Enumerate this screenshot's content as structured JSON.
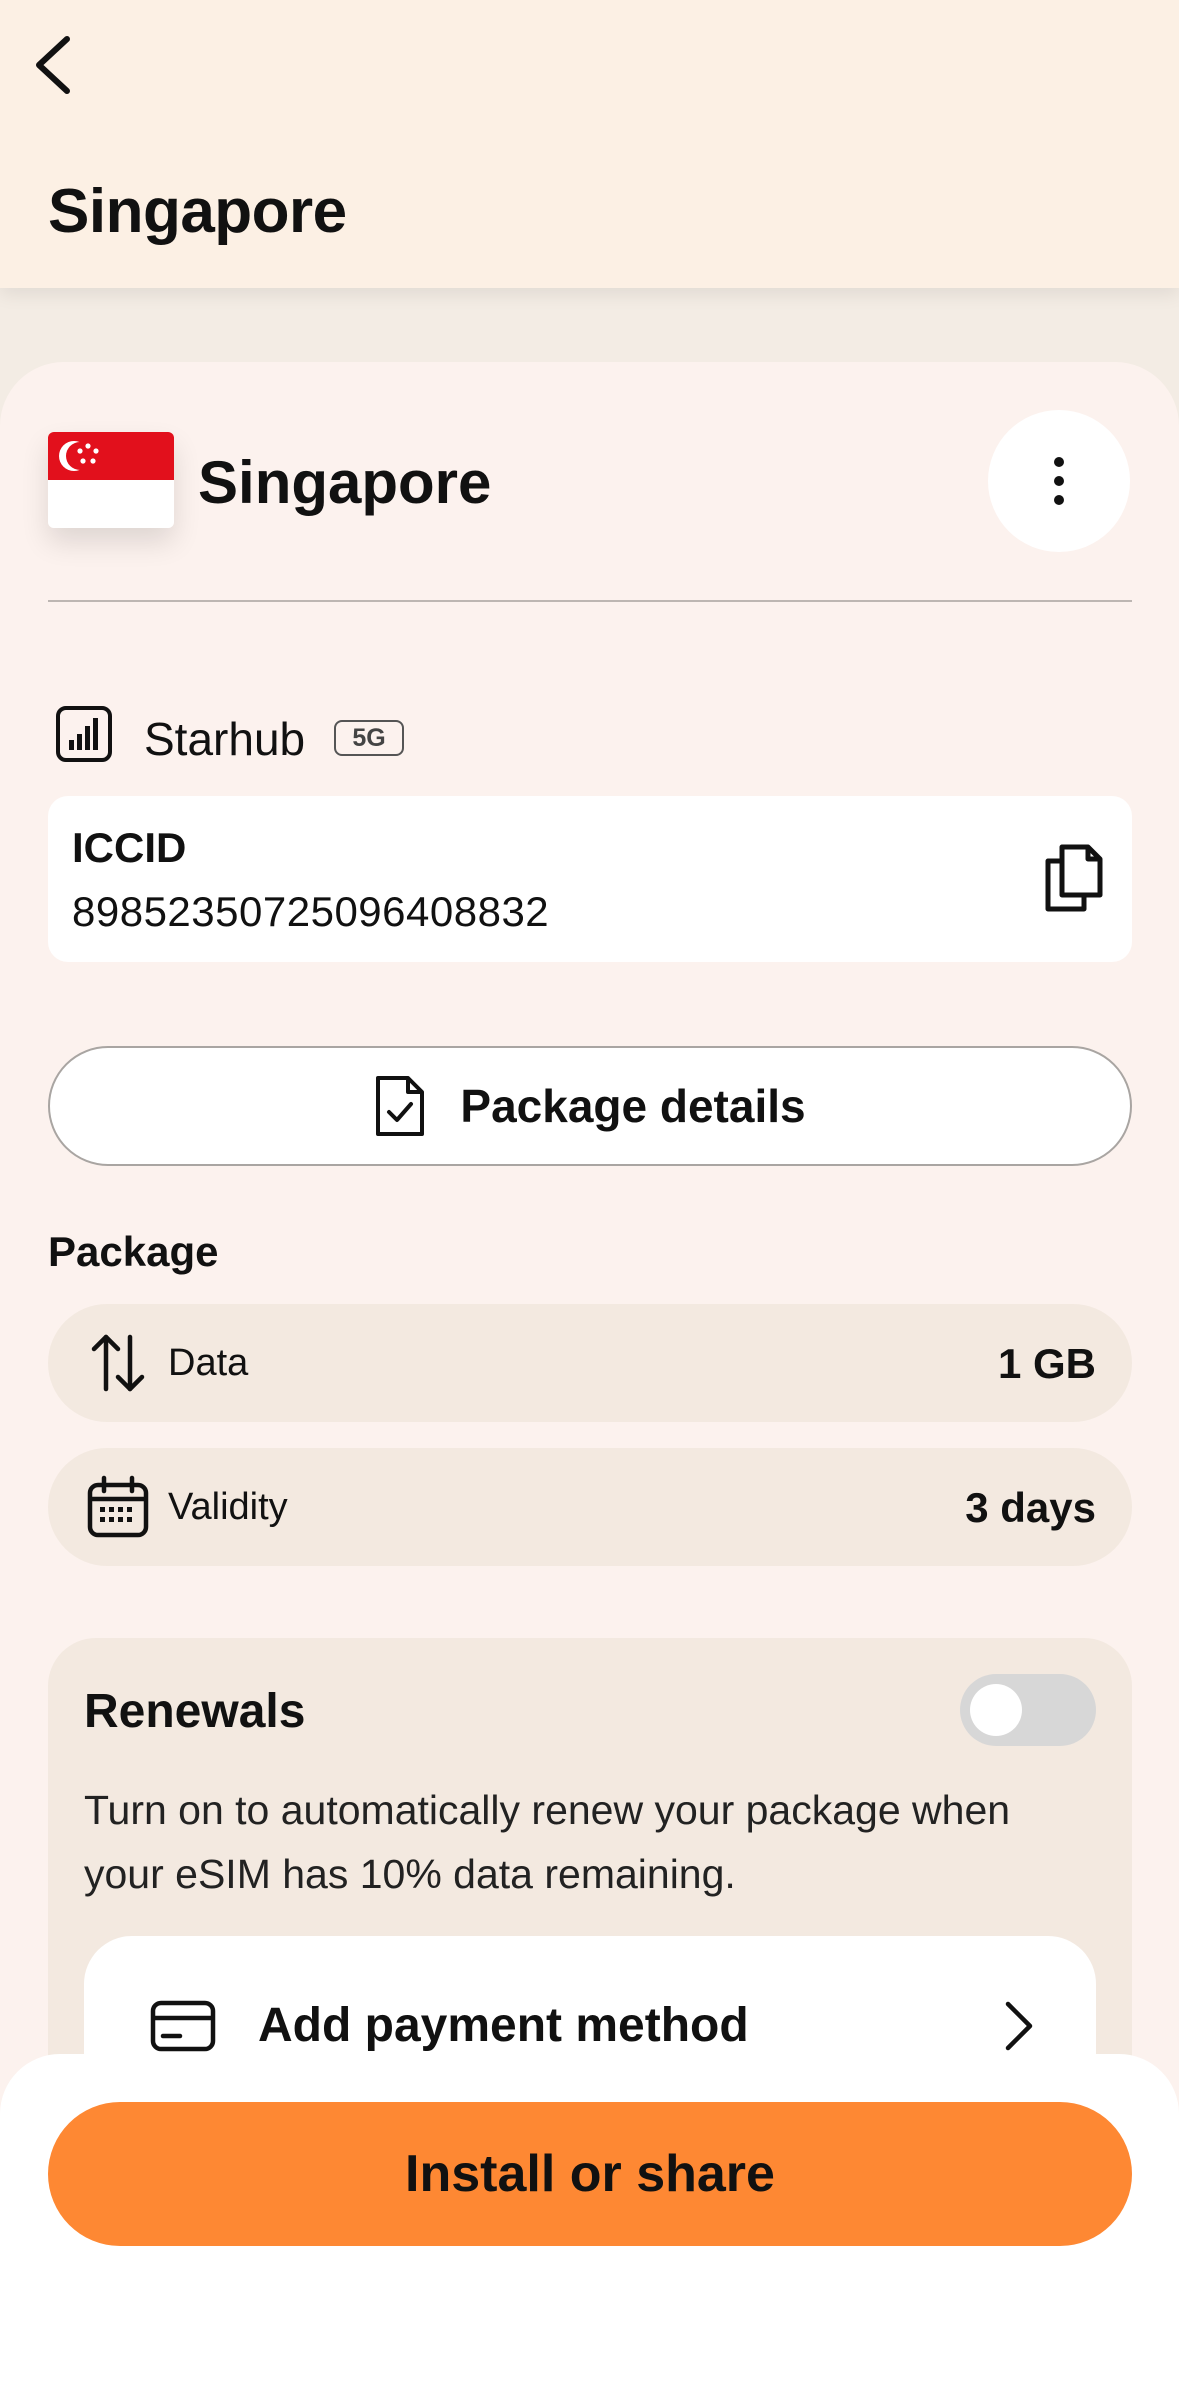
{
  "header": {
    "title": "Singapore"
  },
  "esim": {
    "country": "Singapore",
    "network": "Starhub",
    "network_badge": "5G",
    "iccid_label": "ICCID",
    "iccid_value": "8985235072509640​8832"
  },
  "buttons": {
    "package_details": "Package details",
    "install_or_share": "Install or share"
  },
  "package": {
    "section_title": "Package",
    "rows": [
      {
        "label": "Data",
        "value": "1 GB",
        "icon": "data-transfer-icon"
      },
      {
        "label": "Validity",
        "value": "3 days",
        "icon": "calendar-icon"
      }
    ]
  },
  "renewals": {
    "title": "Renewals",
    "enabled": false,
    "description": "Turn on to automatically renew your package when your eSIM has 10% data remaining.",
    "payment_label": "Add payment method"
  },
  "colors": {
    "accent": "#fe8833",
    "header_bg": "#fcf0e4",
    "card_bg": "#fcf2ee",
    "row_bg": "#f3e9e0",
    "flag_red": "#e2101c"
  }
}
